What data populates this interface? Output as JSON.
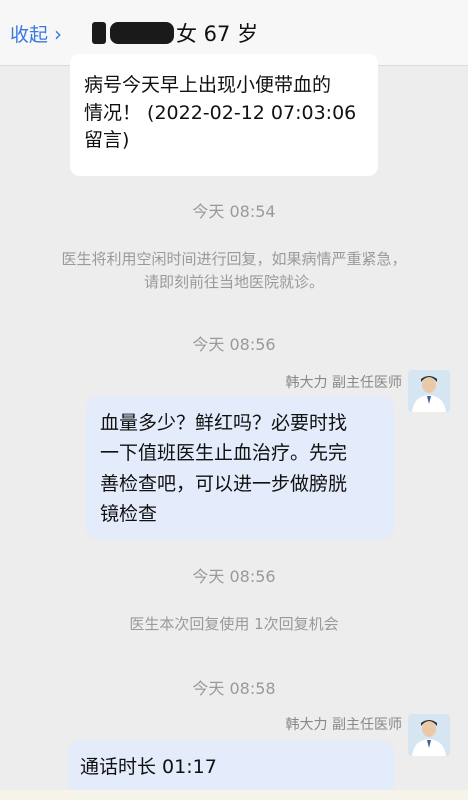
{
  "header": {
    "collapse_label": "收起",
    "chevron": "›",
    "title_prefix_visible": "",
    "title_suffix": "女 67 岁"
  },
  "messages": {
    "patient_msg": {
      "line1": "病号今天早上出现小便带血的",
      "line2": "情况！ (2022-02-12 07:03:06",
      "line3": "留言)"
    },
    "time1": "今天 08:54",
    "sys1_line1": "医生将利用空闲时间进行回复，如果病情严重紧急，",
    "sys1_line2": "请即刻前往当地医院就诊。",
    "time2": "今天 08:56",
    "doctor_name1": "韩大力  副主任医师",
    "doctor_reply": {
      "line1": "血量多少？鲜红吗？必要时找",
      "line2": "一下值班医生止血治疗。先完",
      "line3": "善检查吧，可以进一步做膀胱",
      "line4": "镜检查"
    },
    "time3": "今天 08:56",
    "sys2": "医生本次回复使用 1次回复机会",
    "time4": "今天 08:58",
    "doctor_name2": "韩大力  副主任医师",
    "call_duration": "通话时长 01:17"
  },
  "icons": {
    "avatar": "doctor-avatar",
    "chevron": "chevron-right-icon"
  },
  "colors": {
    "accent": "#3a78e0",
    "doctor_bubble": "#e4ebfa",
    "background": "#ededed"
  }
}
